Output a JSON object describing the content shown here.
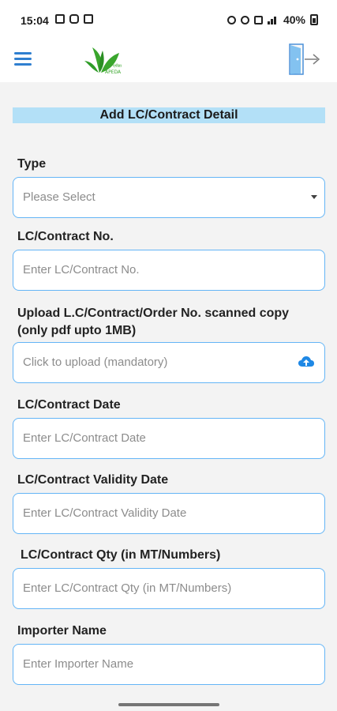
{
  "status_bar": {
    "time": "15:04",
    "battery": "40%"
  },
  "header": {
    "logo_text": "APEDA",
    "logo_native_text": "एपीडा"
  },
  "form": {
    "title": "Add LC/Contract Detail",
    "fields": [
      {
        "label": "Type",
        "value": "Please Select"
      },
      {
        "label": "LC/Contract No.",
        "placeholder": "Enter LC/Contract No."
      },
      {
        "label_line1": "Upload L.C/Contract/Order No. scanned copy",
        "label_line2": "(only pdf upto 1MB)",
        "placeholder": "Click to upload (mandatory)"
      },
      {
        "label": "LC/Contract Date",
        "placeholder": "Enter LC/Contract Date"
      },
      {
        "label": "LC/Contract Validity Date",
        "placeholder": "Enter LC/Contract Validity Date"
      },
      {
        "label": "LC/Contract Qty (in MT/Numbers)",
        "placeholder": "Enter  LC/Contract Qty (in MT/Numbers)"
      },
      {
        "label": "Importer Name",
        "placeholder": "Enter Importer Name"
      }
    ]
  },
  "colors": {
    "accent": "#64b5f6",
    "title_background": "#b3e0f7",
    "menu": "#2f7fd0",
    "logo_green": "#3aa62d"
  },
  "icons": {
    "menu": "menu-icon",
    "logout": "logout-icon",
    "dropdown": "chevron-down-icon",
    "upload": "cloud-upload-icon"
  }
}
